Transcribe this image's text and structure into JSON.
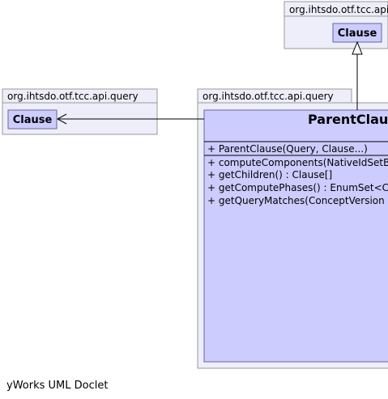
{
  "diagram": {
    "packages": {
      "top_right": {
        "name": "org.ihtsdo.otf.tcc.api",
        "class_name": "Clause"
      },
      "left": {
        "name": "org.ihtsdo.otf.tcc.api.query",
        "class_name": "Clause"
      },
      "main": {
        "name": "org.ihtsdo.otf.tcc.api.query"
      }
    },
    "main_class": {
      "name": "ParentClau",
      "constructors": [
        "+ ParentClause(Query, Clause...)"
      ],
      "methods": [
        "+ computeComponents(NativeIdSetB",
        "+ getChildren() : Clause[]",
        "+ getComputePhases() : EnumSet<C",
        "+ getQueryMatches(ConceptVersion"
      ]
    },
    "footer": "yWorks UML Doclet"
  },
  "colors": {
    "package_fill": "#eeeefa",
    "package_border": "#999999",
    "class_fill": "#ccccff",
    "class_border": "#666699",
    "line": "#000000"
  }
}
